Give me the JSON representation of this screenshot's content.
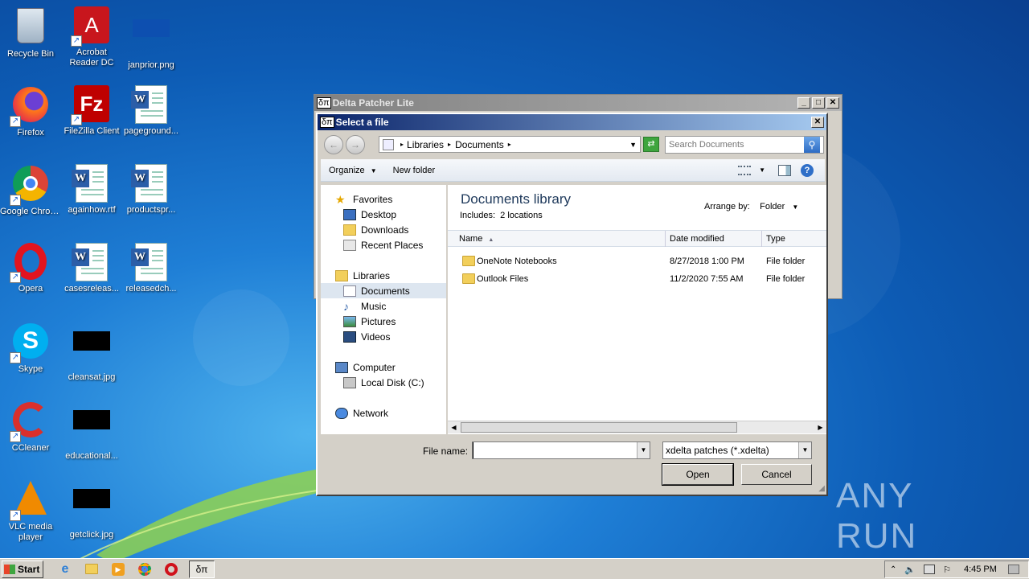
{
  "desktop": {
    "icons": [
      {
        "label": "Recycle Bin",
        "icon": "recycle-bin-icon"
      },
      {
        "label": "Acrobat Reader DC",
        "icon": "acrobat-icon"
      },
      {
        "label": "janprior.png",
        "icon": "image-file-icon"
      },
      {
        "label": "Firefox",
        "icon": "firefox-icon"
      },
      {
        "label": "FileZilla Client",
        "icon": "filezilla-icon"
      },
      {
        "label": "pageground...",
        "icon": "word-doc-icon"
      },
      {
        "label": "Google Chrome",
        "icon": "chrome-icon"
      },
      {
        "label": "againhow.rtf",
        "icon": "word-doc-icon"
      },
      {
        "label": "productspr...",
        "icon": "word-doc-icon"
      },
      {
        "label": "Opera",
        "icon": "opera-icon"
      },
      {
        "label": "casesreleas...",
        "icon": "word-doc-icon"
      },
      {
        "label": "releasedch...",
        "icon": "word-doc-icon"
      },
      {
        "label": "Skype",
        "icon": "skype-icon"
      },
      {
        "label": "cleansat.jpg",
        "icon": "image-file-icon"
      },
      {
        "label": "CCleaner",
        "icon": "ccleaner-icon"
      },
      {
        "label": "educational...",
        "icon": "image-file-icon"
      },
      {
        "label": "VLC media player",
        "icon": "vlc-icon"
      },
      {
        "label": "getclick.jpg",
        "icon": "image-file-icon"
      }
    ],
    "watermark": "ANY RUN"
  },
  "parent_window": {
    "title": "Delta Patcher Lite",
    "app_glyph": "δπ"
  },
  "dialog": {
    "title": "Select a file",
    "breadcrumb": [
      "Libraries",
      "Documents"
    ],
    "search_placeholder": "Search Documents",
    "toolbar": {
      "organize": "Organize",
      "new_folder": "New folder"
    },
    "nav": {
      "favorites": "Favorites",
      "desktop": "Desktop",
      "downloads": "Downloads",
      "recent": "Recent Places",
      "libraries": "Libraries",
      "documents": "Documents",
      "music": "Music",
      "pictures": "Pictures",
      "videos": "Videos",
      "computer": "Computer",
      "local_disk": "Local Disk (C:)",
      "network": "Network"
    },
    "library_title": "Documents library",
    "includes_label": "Includes:",
    "includes_value": "2 locations",
    "arrange_label": "Arrange by:",
    "arrange_value": "Folder",
    "columns": {
      "name": "Name",
      "date": "Date modified",
      "type": "Type"
    },
    "rows": [
      {
        "name": "OneNote Notebooks",
        "date": "8/27/2018 1:00 PM",
        "type": "File folder"
      },
      {
        "name": "Outlook Files",
        "date": "11/2/2020 7:55 AM",
        "type": "File folder"
      }
    ],
    "filename_label": "File name:",
    "filename_value": "",
    "filter_value": "xdelta patches (*.xdelta)",
    "open_label": "Open",
    "cancel_label": "Cancel"
  },
  "taskbar": {
    "start_label": "Start",
    "active_app_glyph": "δπ",
    "clock": "4:45 PM"
  }
}
